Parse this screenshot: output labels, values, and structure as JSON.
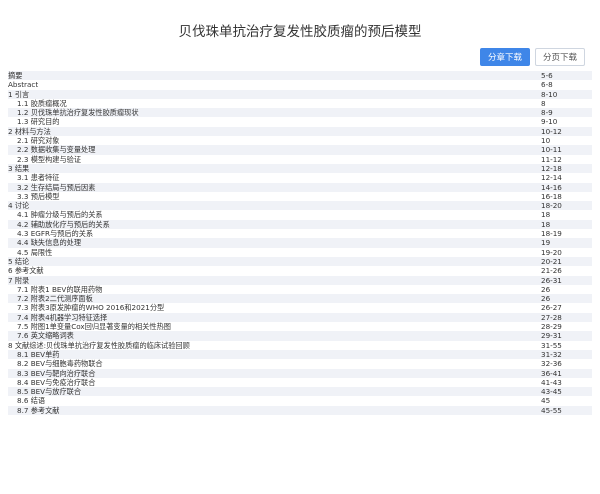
{
  "document": {
    "title": "贝伐珠单抗治疗复发性胶质瘤的预后模型"
  },
  "toolbar": {
    "chapter_download": "分章下载",
    "page_download": "分页下载"
  },
  "toc": [
    {
      "title": "摘要",
      "pages": "5-6",
      "level": 1
    },
    {
      "title": "Abstract",
      "pages": "6-8",
      "level": 1
    },
    {
      "title": "1 引言",
      "pages": "8-10",
      "level": 1
    },
    {
      "title": "1.1 胶质瘤概况",
      "pages": "8",
      "level": 2
    },
    {
      "title": "1.2 贝伐珠单抗治疗复发性胶质瘤现状",
      "pages": "8-9",
      "level": 2
    },
    {
      "title": "1.3 研究目的",
      "pages": "9-10",
      "level": 2
    },
    {
      "title": "2 材料与方法",
      "pages": "10-12",
      "level": 1
    },
    {
      "title": "2.1 研究对象",
      "pages": "10",
      "level": 2
    },
    {
      "title": "2.2 数据收集与变量处理",
      "pages": "10-11",
      "level": 2
    },
    {
      "title": "2.3 模型构建与验证",
      "pages": "11-12",
      "level": 2
    },
    {
      "title": "3 结果",
      "pages": "12-18",
      "level": 1
    },
    {
      "title": "3.1 患者特征",
      "pages": "12-14",
      "level": 2
    },
    {
      "title": "3.2 生存结局与预后因素",
      "pages": "14-16",
      "level": 2
    },
    {
      "title": "3.3 预后模型",
      "pages": "16-18",
      "level": 2
    },
    {
      "title": "4 讨论",
      "pages": "18-20",
      "level": 1
    },
    {
      "title": "4.1 肿瘤分级与预后的关系",
      "pages": "18",
      "level": 2
    },
    {
      "title": "4.2 辅助放化疗与预后的关系",
      "pages": "18",
      "level": 2
    },
    {
      "title": "4.3 EGFR与预后的关系",
      "pages": "18-19",
      "level": 2
    },
    {
      "title": "4.4 缺失信息的处理",
      "pages": "19",
      "level": 2
    },
    {
      "title": "4.5 局限性",
      "pages": "19-20",
      "level": 2
    },
    {
      "title": "5 结论",
      "pages": "20-21",
      "level": 1
    },
    {
      "title": "6 参考文献",
      "pages": "21-26",
      "level": 1
    },
    {
      "title": "7 附录",
      "pages": "26-31",
      "level": 1
    },
    {
      "title": "7.1 附表1 BEV的联用药物",
      "pages": "26",
      "level": 2
    },
    {
      "title": "7.2 附表2二代测序面板",
      "pages": "26",
      "level": 2
    },
    {
      "title": "7.3 附表3原发肿瘤的WHO 2016和2021分型",
      "pages": "26-27",
      "level": 2
    },
    {
      "title": "7.4 附表4机器学习特征选择",
      "pages": "27-28",
      "level": 2
    },
    {
      "title": "7.5 附图1单变量Cox回归显著变量的相关性热图",
      "pages": "28-29",
      "level": 2
    },
    {
      "title": "7.6 英文缩略词表",
      "pages": "29-31",
      "level": 2
    },
    {
      "title": "8 文献综述:贝伐珠单抗治疗复发性胶质瘤的临床试验回顾",
      "pages": "31-55",
      "level": 1
    },
    {
      "title": "8.1 BEV单药",
      "pages": "31-32",
      "level": 2
    },
    {
      "title": "8.2 BEV与细胞毒药物联合",
      "pages": "32-36",
      "level": 2
    },
    {
      "title": "8.3 BEV与靶向治疗联合",
      "pages": "36-41",
      "level": 2
    },
    {
      "title": "8.4 BEV与免疫治疗联合",
      "pages": "41-43",
      "level": 2
    },
    {
      "title": "8.5 BEV与放疗联合",
      "pages": "43-45",
      "level": 2
    },
    {
      "title": "8.6 结语",
      "pages": "45",
      "level": 2
    },
    {
      "title": "8.7 参考文献",
      "pages": "45-55",
      "level": 2
    }
  ]
}
